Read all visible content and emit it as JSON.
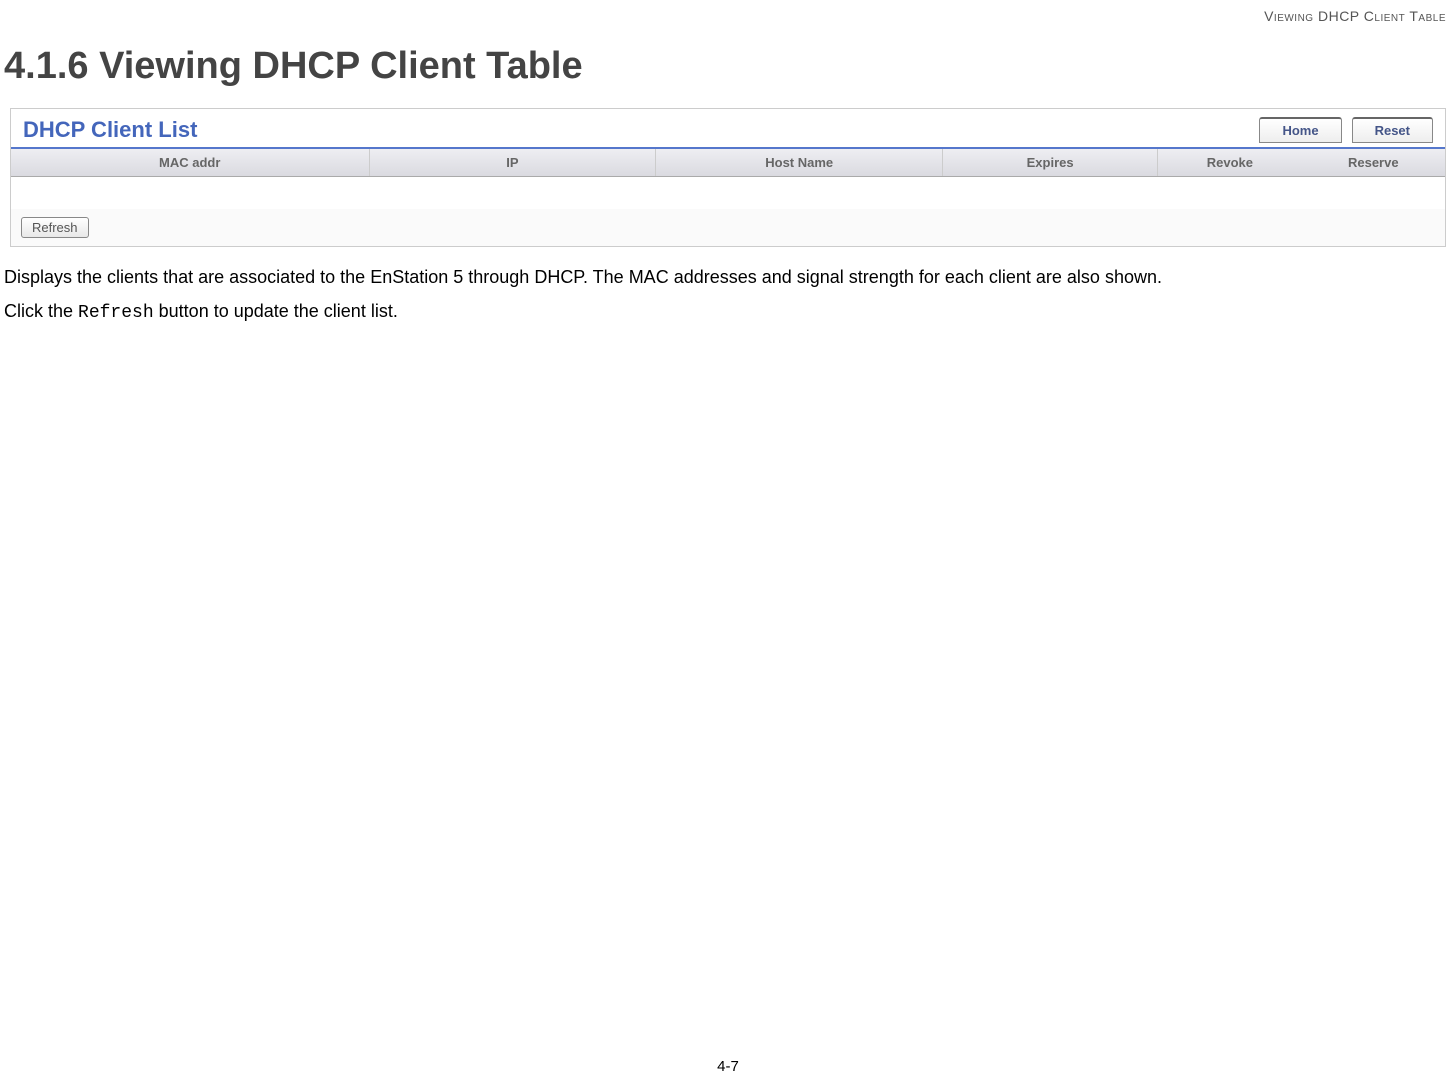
{
  "header": {
    "running_title": "Viewing DHCP Client Table"
  },
  "section": {
    "heading": "4.1.6 Viewing DHCP Client Table"
  },
  "screenshot": {
    "panel_title": "DHCP Client List",
    "tabs": {
      "home": "Home",
      "reset": "Reset"
    },
    "columns": {
      "mac": "MAC addr",
      "ip": "IP",
      "host": "Host Name",
      "expires": "Expires",
      "revoke": "Revoke",
      "reserve": "Reserve"
    },
    "refresh_label": "Refresh"
  },
  "body": {
    "description": "Displays the clients that are associated to the EnStation 5 through DHCP. The MAC addresses and signal strength for each client are also shown.",
    "instruction_prefix": "Click the ",
    "instruction_code": "Refresh",
    "instruction_suffix": " button to update the client list."
  },
  "footer": {
    "page_number": "4-7"
  }
}
